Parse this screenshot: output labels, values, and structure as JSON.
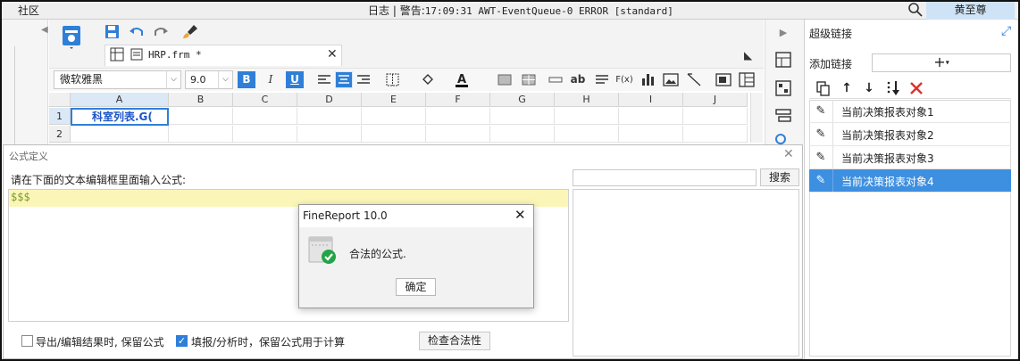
{
  "topbar": {
    "community": "社区",
    "log_label": "日志",
    "separator": "|",
    "warning_label": "警告:",
    "log_message": "17:09:31 AWT-EventQueue-0 ERROR [standard]",
    "user": "黄至尊"
  },
  "editor": {
    "file_tab": "HRP.frm *",
    "font_family": "微软雅黑",
    "font_size": "9.0",
    "format_bold": "B",
    "format_italic": "I",
    "format_underline": "U",
    "text_ab": "ab",
    "text_fx": "F(x)"
  },
  "sheet": {
    "columns": [
      "A",
      "B",
      "C",
      "D",
      "E",
      "F",
      "G",
      "H",
      "I",
      "J"
    ],
    "rows": [
      "1",
      "2"
    ],
    "cell_a1": "科室列表.G("
  },
  "hyperlink_panel": {
    "title": "超级链接",
    "add_label": "添加链接",
    "add_button": "+",
    "items": [
      {
        "label": "当前决策报表对象1",
        "selected": false
      },
      {
        "label": "当前决策报表对象2",
        "selected": false
      },
      {
        "label": "当前决策报表对象3",
        "selected": false
      },
      {
        "label": "当前决策报表对象4",
        "selected": true
      }
    ]
  },
  "formula_dialog": {
    "title": "公式定义",
    "prompt": "请在下面的文本编辑框里面输入公式:",
    "formula": "$$$",
    "search_button": "搜索",
    "option_keep_export": "导出/编辑结果时, 保留公式",
    "option_keep_fill": "填报/分析时，保留公式用于计算",
    "option_keep_export_checked": false,
    "option_keep_fill_checked": true,
    "check_button": "检查合法性"
  },
  "message_box": {
    "title": "FineReport 10.0",
    "message": "合法的公式.",
    "ok_button": "确定"
  },
  "colors": {
    "accent": "#2f7fd8",
    "selected_row": "#3d8fe0",
    "formula_line": "#fbf6b8",
    "success": "#22a447",
    "delete": "#e0322b",
    "user_bg": "#cfe3f6"
  }
}
